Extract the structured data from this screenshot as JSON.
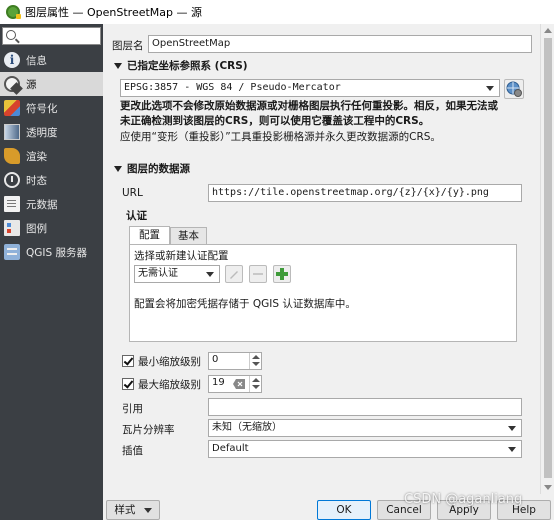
{
  "window": {
    "title": "图层属性 — OpenStreetMap — 源"
  },
  "sidebar": {
    "search_placeholder": "",
    "items": [
      {
        "label": "信息",
        "icon": "info-icon"
      },
      {
        "label": "源",
        "icon": "source-icon"
      },
      {
        "label": "符号化",
        "icon": "symbology-icon"
      },
      {
        "label": "透明度",
        "icon": "transparency-icon"
      },
      {
        "label": "渲染",
        "icon": "rendering-icon"
      },
      {
        "label": "时态",
        "icon": "temporal-icon"
      },
      {
        "label": "元数据",
        "icon": "metadata-icon"
      },
      {
        "label": "图例",
        "icon": "legend-icon"
      },
      {
        "label": "QGIS 服务器",
        "icon": "qgis-server-icon"
      }
    ],
    "active_index": 1
  },
  "layer_name": {
    "label": "图层名",
    "value": "OpenStreetMap"
  },
  "crs": {
    "heading": "已指定坐标参照系 (CRS)",
    "value": "EPSG:3857 - WGS 84 / Pseudo-Mercator",
    "warning_line1": "更改此选项不会修改原始数据源或对栅格图层执行任何重投影。相反，如果无法或",
    "warning_line2": "未正确检测到该图层的CRS，则可以使用它覆盖该工程中的CRS。",
    "hint": "应使用“变形（重投影）”工具重投影栅格源并永久更改数据源的CRS。"
  },
  "datasource": {
    "heading": "图层的数据源",
    "url_label": "URL",
    "url_value": "https://tile.openstreetmap.org/{z}/{x}/{y}.png",
    "auth_label": "认证",
    "tabs": [
      "配置",
      "基本"
    ],
    "active_tab": 0,
    "config_prompt": "选择或新建认证配置",
    "config_value": "无需认证",
    "config_note": "配置会将加密凭据存储于 QGIS 认证数据库中。",
    "min_zoom_label": "最小缩放级别",
    "min_zoom_value": "0",
    "min_zoom_checked": true,
    "max_zoom_label": "最大缩放级别",
    "max_zoom_value": "19",
    "max_zoom_checked": true,
    "reference_label": "引用",
    "reference_value": "",
    "tile_res_label": "瓦片分辨率",
    "tile_res_value": "未知（无缩放）",
    "interp_label": "插值",
    "interp_value": "Default"
  },
  "buttons": {
    "style": "样式",
    "ok": "OK",
    "cancel": "Cancel",
    "apply": "Apply",
    "help": "Help"
  },
  "watermark": "CSDN @aganliang",
  "colors": {
    "sidebar_bg": "#3b3f44",
    "sidebar_active_bg": "#d9d9d9",
    "panel_bg": "#f0f0f0",
    "default_button_border": "#0078d7"
  }
}
